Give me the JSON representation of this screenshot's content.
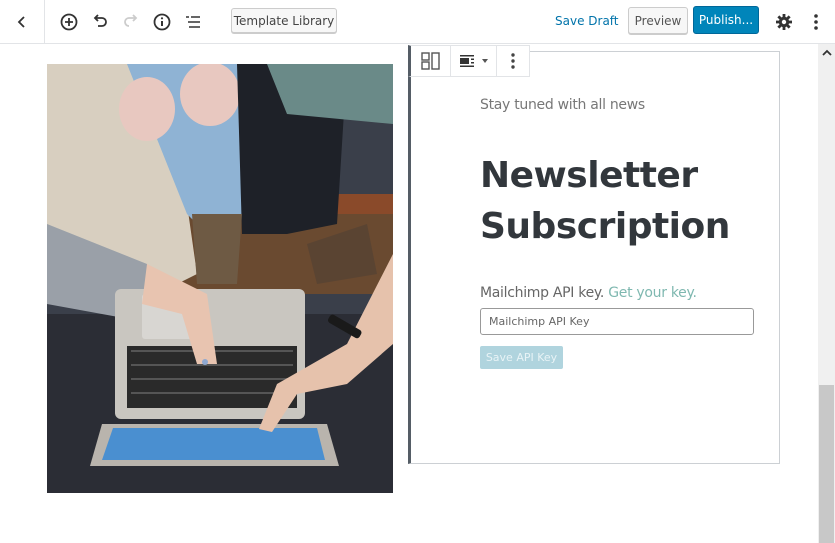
{
  "topbar": {
    "back_icon": "chevron-left-icon",
    "tools": [
      {
        "name": "add-block",
        "icon": "plus-circle-icon"
      },
      {
        "name": "undo",
        "icon": "undo-icon"
      },
      {
        "name": "redo",
        "icon": "redo-icon",
        "disabled": true
      },
      {
        "name": "info",
        "icon": "info-icon"
      },
      {
        "name": "block-navigation",
        "icon": "list-icon"
      }
    ],
    "template_library_label": "Template Library",
    "save_draft_label": "Save Draft",
    "preview_label": "Preview",
    "publish_label": "Publish...",
    "settings_icon": "gear-icon",
    "more_icon": "more-vertical-icon",
    "accent_color": "#0085ba"
  },
  "block_toolbar": {
    "items": [
      {
        "name": "columns-layout",
        "icon": "columns-icon"
      },
      {
        "name": "alignment",
        "icon": "align-icon",
        "has_dropdown": true
      },
      {
        "name": "more-options",
        "icon": "more-vertical-icon"
      }
    ]
  },
  "image_block": {
    "description": "Overhead photo of people pointing at a laptop keyboard and screen"
  },
  "newsletter": {
    "eyebrow": "Stay tuned with all news",
    "heading_line1": "Newsletter",
    "heading_line2": "Subscription",
    "api_label": "Mailchimp API key.",
    "api_link": "Get your key.",
    "api_placeholder": "Mailchimp API Key",
    "save_button": "Save API Key"
  }
}
